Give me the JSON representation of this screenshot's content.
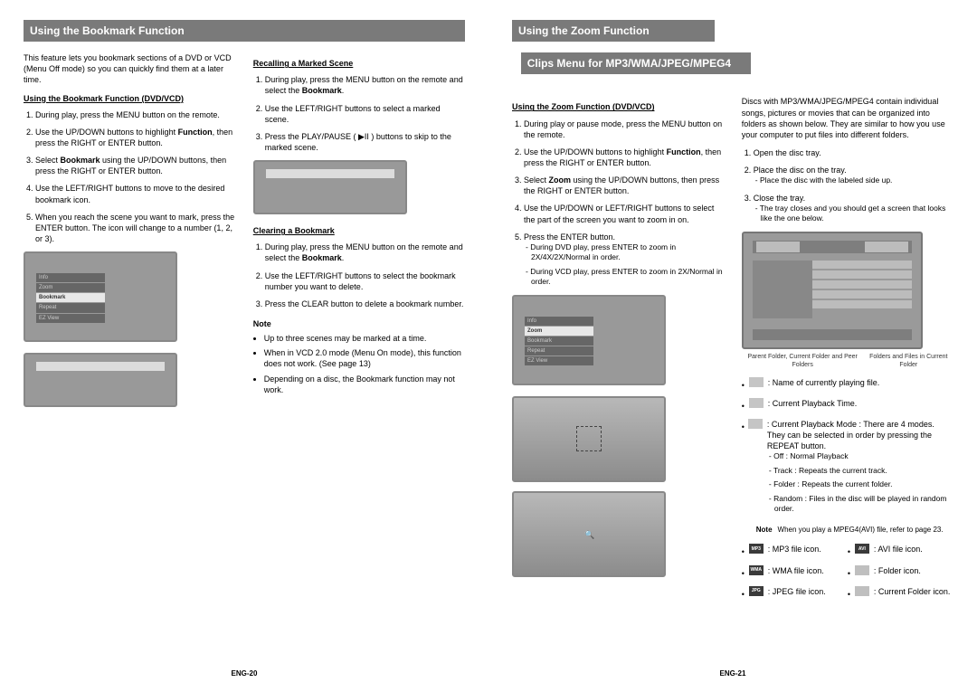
{
  "left": {
    "header": "Using the Bookmark Function",
    "intro": "This feature lets you bookmark sections of a DVD or VCD (Menu Off mode) so you can quickly find them at a later time.",
    "h1": "Using the Bookmark Function (DVD/VCD)",
    "s1": "During play, press the MENU button on the remote.",
    "s2a": "Use the UP/DOWN buttons to highlight ",
    "s2b": "Function",
    "s2c": ", then press the RIGHT or ENTER button.",
    "s3a": "Select ",
    "s3b": "Bookmark",
    "s3c": " using the UP/DOWN buttons, then press the RIGHT or ENTER button.",
    "s4": "Use the LEFT/RIGHT buttons to move to the desired bookmark icon.",
    "s5": "When you reach the scene you want to mark, press the ENTER button. The icon will change to a number (1, 2, or 3).",
    "menu": {
      "info": "Info",
      "zoom": "Zoom",
      "bookmark": "Bookmark",
      "repeat": "Repeat",
      "ez": "EZ View"
    },
    "h2": "Recalling a Marked Scene",
    "r1a": "During play, press the MENU button on the remote and select the ",
    "r1b": "Bookmark",
    "r1c": ".",
    "r2": "Use the LEFT/RIGHT buttons to select a marked scene.",
    "r3": "Press the PLAY/PAUSE ( ▶II ) buttons to skip to the marked scene.",
    "h3": "Clearing a Bookmark",
    "c1a": "During play, press the MENU button on the remote and select the ",
    "c1b": "Bookmark",
    "c1c": ".",
    "c2": "Use the LEFT/RIGHT buttons to select the bookmark number you want to delete.",
    "c3": "Press the CLEAR button to delete a bookmark number.",
    "note_h": "Note",
    "n1": "Up to three scenes may be marked at a time.",
    "n2": "When in VCD 2.0 mode (Menu On mode), this function does not work. (See page 13)",
    "n3": "Depending on a disc, the Bookmark function may not work.",
    "footer": "ENG-20"
  },
  "right": {
    "header1": "Using the Zoom Function",
    "header2": "Clips Menu for MP3/WMA/JPEG/MPEG4",
    "zh": "Using the Zoom Function (DVD/VCD)",
    "z1": "During play or pause mode, press the MENU button on the remote.",
    "z2a": "Use the UP/DOWN buttons to highlight ",
    "z2b": "Function",
    "z2c": ", then press the RIGHT or ENTER button.",
    "z3a": "Select ",
    "z3b": "Zoom",
    "z3c": " using the UP/DOWN buttons, then press the RIGHT or ENTER button.",
    "z4": "Use the UP/DOWN or LEFT/RIGHT buttons to select the part of the screen you want to zoom in on.",
    "z5": "Press the ENTER button.",
    "z5d1": "- During DVD play, press ENTER to zoom in 2X/4X/2X/Normal in order.",
    "z5d2": "- During VCD play, press ENTER to zoom in 2X/Normal in order.",
    "zmenu": {
      "info": "Info",
      "zoom": "Zoom",
      "bookmark": "Bookmark",
      "repeat": "Repeat",
      "ez": "EZ View"
    },
    "cintro": "Discs with MP3/WMA/JPEG/MPEG4 contain individual songs, pictures or movies that can be organized into folders as shown below. They are similar to how you use your computer to put files into different folders.",
    "c1": "Open the disc tray.",
    "c2": "Place the disc on the tray.",
    "c2d": "- Place the disc with the labeled side up.",
    "c3": "Close the tray.",
    "c3d": "- The tray closes and you should get a screen that looks like the one below.",
    "cap1": "Parent Folder, Current Folder and Peer Folders",
    "cap2": "Folders and Files in Current Folder",
    "i1": ": Name of currently playing file.",
    "i2": ": Current Playback Time.",
    "i3": ": Current Playback Mode : There are 4 modes. They can be selected in order by pressing the REPEAT button.",
    "i3a": "- Off : Normal Playback",
    "i3b": "- Track : Repeats the current track.",
    "i3c": "- Folder : Repeats the current folder.",
    "i3d": "- Random : Files in the disc will be played in random order.",
    "note2a": "Note",
    "note2b": "When you play a MPEG4(AVI) file, refer to page 23.",
    "g1": ": MP3 file icon.",
    "g2": ": AVI file icon.",
    "g3": ": WMA file icon.",
    "g4": ": Folder icon.",
    "g5": ": JPEG file icon.",
    "g6": ": Current Folder icon.",
    "footer": "ENG-21"
  }
}
